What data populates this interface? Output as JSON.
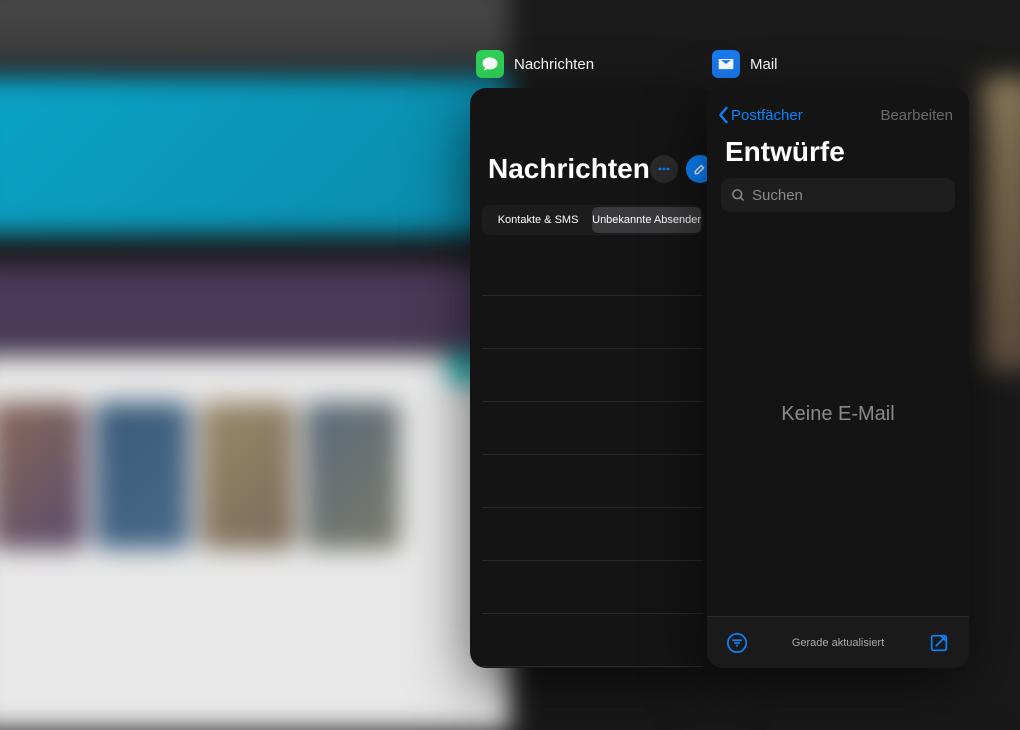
{
  "apps": {
    "messages": {
      "label": "Nachrichten",
      "icon": "messages-icon"
    },
    "mail": {
      "label": "Mail",
      "icon": "mail-icon"
    }
  },
  "messages": {
    "title": "Nachrichten",
    "segments": {
      "contacts": "Kontakte & SMS",
      "unknown": "Unbekannte Absender"
    }
  },
  "mail": {
    "back": "Postfächer",
    "edit": "Bearbeiten",
    "title": "Entwürfe",
    "search_placeholder": "Suchen",
    "empty": "Keine E-Mail",
    "status": "Gerade aktualisiert"
  }
}
